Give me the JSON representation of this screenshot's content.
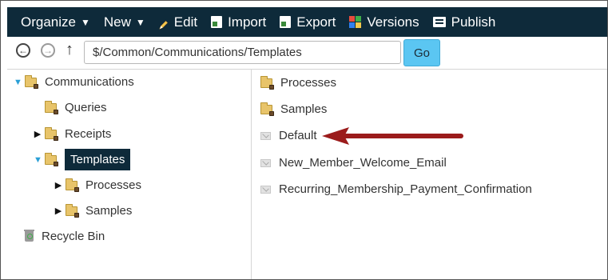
{
  "toolbar": {
    "organize": "Organize",
    "new": "New",
    "edit": "Edit",
    "import": "Import",
    "export": "Export",
    "versions": "Versions",
    "publish": "Publish",
    "icons": {
      "edit": "pencil-icon",
      "import": "import-icon",
      "export": "export-icon",
      "versions": "versions-icon",
      "publish": "publish-icon"
    }
  },
  "address": {
    "path": "$/Common/Communications/Templates",
    "go_label": "Go"
  },
  "tree": {
    "communications": "Communications",
    "queries": "Queries",
    "receipts": "Receipts",
    "templates": "Templates",
    "processes": "Processes",
    "samples": "Samples",
    "recycle_bin": "Recycle Bin"
  },
  "content": {
    "items": [
      "Processes",
      "Samples",
      "Default",
      "New_Member_Welcome_Email",
      "Recurring_Membership_Payment_Confirmation"
    ]
  },
  "colors": {
    "toolbar_bg": "#0e2a3a",
    "go_button": "#5bc6f2",
    "annotation_arrow": "#9b1b1b"
  }
}
